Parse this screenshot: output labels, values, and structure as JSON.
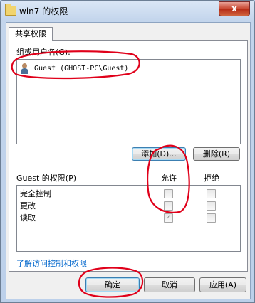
{
  "window": {
    "title": "win7 的权限",
    "close_label": "x"
  },
  "tabs": [
    {
      "label": "共享权限"
    }
  ],
  "group_label": "组或用户名(G):",
  "users": [
    {
      "label": "Guest (GHOST-PC\\Guest)",
      "icon": "user-icon"
    }
  ],
  "buttons": {
    "add": "添加(D)...",
    "remove": "删除(R)",
    "ok": "确定",
    "cancel": "取消",
    "apply": "应用(A)"
  },
  "permissions": {
    "label": "Guest 的权限(P)",
    "allow_header": "允许",
    "deny_header": "拒绝",
    "rows": [
      {
        "name": "完全控制",
        "allow": false,
        "deny": false
      },
      {
        "name": "更改",
        "allow": false,
        "deny": false
      },
      {
        "name": "读取",
        "allow": true,
        "deny": false
      }
    ]
  },
  "link": "了解访问控制和权限",
  "annotation_color": "#e0001a"
}
